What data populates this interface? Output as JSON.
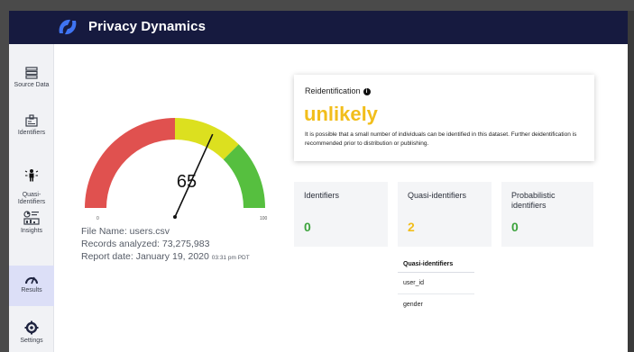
{
  "app": {
    "title": "Privacy Dynamics"
  },
  "sidebar": {
    "items": [
      {
        "label": "Source Data",
        "icon": "database-icon"
      },
      {
        "label": "Identifiers",
        "icon": "id-card-icon"
      },
      {
        "label": "Quasi-\nIdentifiers",
        "icon": "person-burst-icon"
      },
      {
        "label": "Insights",
        "icon": "insights-icon"
      },
      {
        "label": "Results",
        "icon": "gauge-icon",
        "active": true
      },
      {
        "label": "Settings",
        "icon": "gear-icon"
      }
    ]
  },
  "gauge": {
    "value": 65,
    "min": 0,
    "max": 100,
    "min_label": "0",
    "max_label": "100",
    "colors": {
      "red": "#e0514f",
      "yellow": "#dce01f",
      "green": "#56bf3f"
    }
  },
  "file_info": {
    "file_name": "File Name: users.csv",
    "records": "Records analyzed: 73,275,983",
    "report_date": "Report date: January 19, 2020",
    "report_time": "03:31 pm PDT"
  },
  "reidentification": {
    "title": "Reidentification",
    "verdict": "unlikely",
    "description": "It is possible that a small number of individuals can be identified in this dataset. Further deidentification is recommended prior to distribution or publishing.",
    "verdict_color": "#f2be1b"
  },
  "stats": [
    {
      "title": "Identifiers",
      "value": "0",
      "color": "#3ca33c"
    },
    {
      "title": "Quasi-identifiers",
      "value": "2",
      "color": "#f2be1b"
    },
    {
      "title": "Probabilistic identifiers",
      "value": "0",
      "color": "#3ca33c"
    }
  ],
  "quasi_table": {
    "header": "Quasi-identifiers",
    "rows": [
      "user_id",
      "gender"
    ]
  }
}
